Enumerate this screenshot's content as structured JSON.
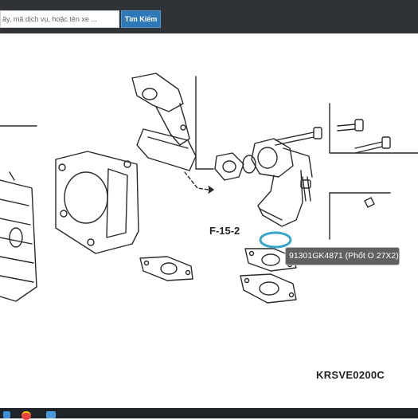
{
  "search": {
    "placeholder": "ãy, mã dịch vụ, hoặc tên xe ...",
    "button_label": "Tìm Kiếm"
  },
  "diagram": {
    "reference_label": "F-15-2",
    "code": "KRSVE0200C"
  },
  "tooltip": {
    "text": "91301GK4871 (Phốt O 27X2)"
  },
  "colors": {
    "topbar": "#2f3337",
    "button": "#2f79b9",
    "highlight": "#37a5c9",
    "tooltip": "#5e6062"
  },
  "taskbar": {
    "icons": [
      "windows-icon",
      "chrome-icon",
      "app-icon"
    ]
  }
}
